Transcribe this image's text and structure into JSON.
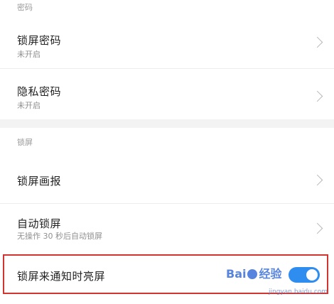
{
  "sections": {
    "password_header": "密码",
    "lockscreen_header": "锁屏"
  },
  "rows": {
    "lock_password": {
      "title": "锁屏密码",
      "subtitle": "未开启"
    },
    "privacy_password": {
      "title": "隐私密码",
      "subtitle": "未开启"
    },
    "lock_wallpaper": {
      "title": "锁屏画报"
    },
    "auto_lock": {
      "title": "自动锁屏",
      "subtitle": "无操作 30 秒后自动锁屏"
    },
    "wake_on_notification": {
      "title": "锁屏来通知时亮屏",
      "toggle_on": true
    }
  },
  "watermark": {
    "brand_left": "Bai",
    "brand_right": "经验",
    "url": "jingyan.baidu.com"
  },
  "colors": {
    "accent": "#2f8df0",
    "highlight": "#d0352f"
  }
}
